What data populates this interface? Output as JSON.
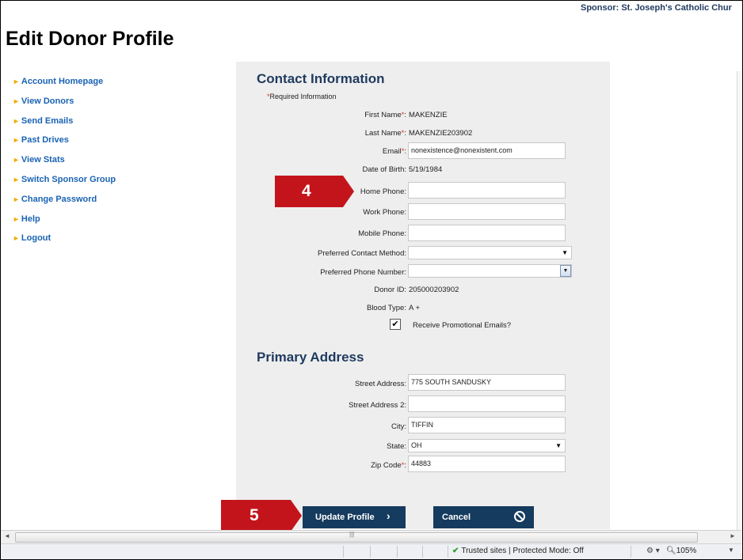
{
  "header": {
    "sponsor": "Sponsor: St. Joseph's Catholic Chur",
    "page_title": "Edit Donor Profile"
  },
  "nav": {
    "items": [
      "Account Homepage",
      "View Donors",
      "Send Emails",
      "Past Drives",
      "View Stats",
      "Switch Sponsor Group",
      "Change Password",
      "Help",
      "Logout"
    ]
  },
  "contact": {
    "title": "Contact Information",
    "required_note": "Required Information",
    "first_name_label": "First Name",
    "first_name": "MAKENZIE",
    "last_name_label": "Last Name",
    "last_name": "MAKENZIE203902",
    "email_label": "Email",
    "email": "nonexistence@nonexistent.com",
    "dob_label": "Date of Birth:",
    "dob": "5/19/1984",
    "home_phone_label": "Home Phone:",
    "home_phone": "",
    "work_phone_label": "Work Phone:",
    "work_phone": "",
    "mobile_phone_label": "Mobile Phone:",
    "mobile_phone": "",
    "pref_contact_label": "Preferred Contact Method:",
    "pref_contact": "",
    "pref_phone_label": "Preferred Phone Number:",
    "pref_phone": "",
    "donor_id_label": "Donor ID:",
    "donor_id": "205000203902",
    "blood_type_label": "Blood Type:",
    "blood_type": "A +",
    "promo_label": "Receive Promotional Emails?",
    "promo_checked": true
  },
  "address": {
    "title": "Primary Address",
    "street_label": "Street Address:",
    "street": "775 SOUTH SANDUSKY",
    "street2_label": "Street Address 2:",
    "street2": "",
    "city_label": "City:",
    "city": "TIFFIN",
    "state_label": "State:",
    "state": "OH",
    "zip_label": "Zip Code",
    "zip": "44883"
  },
  "actions": {
    "update_label": "Update Profile",
    "cancel_label": "Cancel"
  },
  "callouts": {
    "step4": "4",
    "step5": "5"
  },
  "statusbar": {
    "trusted": "Trusted sites | Protected Mode: Off",
    "zoom": "105%"
  },
  "colors": {
    "nav_link": "#1a63b3",
    "heading": "#1f3a5f",
    "required": "#e0352b",
    "button_bg": "#153b5e",
    "callout": "#c4141b",
    "panel_bg": "#eeeeee"
  }
}
